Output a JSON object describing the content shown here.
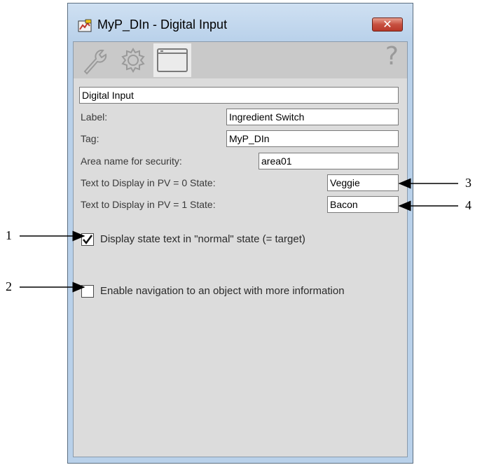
{
  "window": {
    "title": "MyP_DIn - Digital Input",
    "close_icon": "close-x-icon"
  },
  "toolbar": {
    "tabs": [
      {
        "icon": "wrench-icon",
        "active": false
      },
      {
        "icon": "gear-icon",
        "active": false
      },
      {
        "icon": "window-icon",
        "active": true
      }
    ],
    "help_glyph": "?"
  },
  "form": {
    "description": "Digital Input",
    "label_caption": "Label:",
    "label_value": "Ingredient Switch",
    "tag_caption": "Tag:",
    "tag_value": "MyP_DIn",
    "area_caption": "Area name for security:",
    "area_value": "area01",
    "pv0_caption": "Text to Display in PV = 0 State:",
    "pv0_value": "Veggie",
    "pv1_caption": "Text to Display in PV = 1 State:",
    "pv1_value": "Bacon"
  },
  "options": {
    "normal_state": {
      "label": "Display state text in \"normal\" state (= target)",
      "checked": true
    },
    "navigation": {
      "label": "Enable navigation to an object with more information",
      "checked": false
    }
  },
  "callouts": {
    "c1": "1",
    "c2": "2",
    "c3": "3",
    "c4": "4"
  }
}
